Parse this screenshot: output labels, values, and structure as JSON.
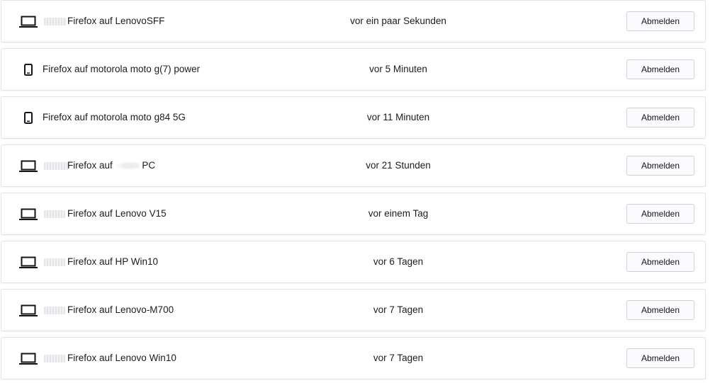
{
  "devices": [
    {
      "type": "laptop",
      "icon": "laptop-icon",
      "name": "Firefox auf LenovoSFF",
      "last_used": "vor ein paar Sekunden",
      "button": "Abmelden"
    },
    {
      "type": "mobile",
      "icon": "mobile-icon",
      "name": "Firefox auf motorola moto g(7) power",
      "last_used": "vor 5 Minuten",
      "button": "Abmelden"
    },
    {
      "type": "mobile",
      "icon": "mobile-icon",
      "name": "Firefox auf motorola moto g84 5G",
      "last_used": "vor 11 Minuten",
      "button": "Abmelden"
    },
    {
      "type": "laptop",
      "icon": "laptop-icon",
      "name_a": "Firefox auf",
      "name_b": "PC",
      "last_used": "vor 21 Stunden",
      "button": "Abmelden"
    },
    {
      "type": "laptop",
      "icon": "laptop-icon",
      "name": "Firefox auf Lenovo V15",
      "last_used": "vor einem Tag",
      "button": "Abmelden"
    },
    {
      "type": "laptop",
      "icon": "laptop-icon",
      "name": "Firefox auf HP Win10",
      "last_used": "vor 6 Tagen",
      "button": "Abmelden"
    },
    {
      "type": "laptop",
      "icon": "laptop-icon",
      "name": "Firefox auf Lenovo-M700",
      "last_used": "vor 7 Tagen",
      "button": "Abmelden"
    },
    {
      "type": "laptop",
      "icon": "laptop-icon",
      "name": "Firefox auf Lenovo Win10",
      "last_used": "vor 7 Tagen",
      "button": "Abmelden"
    }
  ]
}
